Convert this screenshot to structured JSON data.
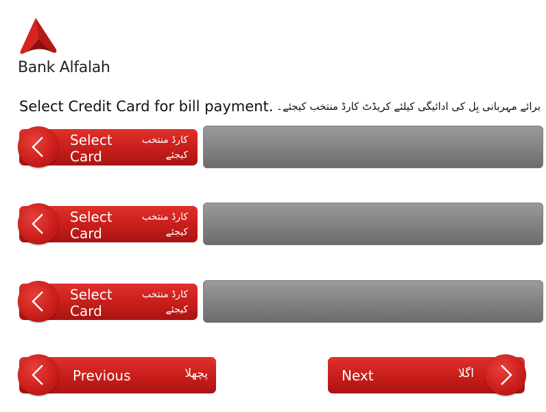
{
  "brand": {
    "name": "Bank Alfalah",
    "color": "#d6231e"
  },
  "instruction": {
    "english": "Select Credit Card for bill payment.",
    "urdu": "برائے مہربانی بِل کی ادائیگی کیلئے کریڈٹ کارڈ منتخب کیجئے۔"
  },
  "card_options": [
    {
      "label_en": "Select Card",
      "label_ur": "کارڈ منتخب کیجئے",
      "value": "",
      "icon": "chevron-left-icon"
    },
    {
      "label_en": "Select Card",
      "label_ur": "کارڈ منتخب کیجئے",
      "value": "",
      "icon": "chevron-left-icon"
    },
    {
      "label_en": "Select Card",
      "label_ur": "کارڈ منتخب کیجئے",
      "value": "",
      "icon": "chevron-left-icon"
    }
  ],
  "navigation": {
    "previous": {
      "label_en": "Previous",
      "label_ur": "پچھلا",
      "icon": "chevron-left-icon"
    },
    "next": {
      "label_en": "Next",
      "label_ur": "اگلا",
      "icon": "chevron-right-icon"
    }
  }
}
